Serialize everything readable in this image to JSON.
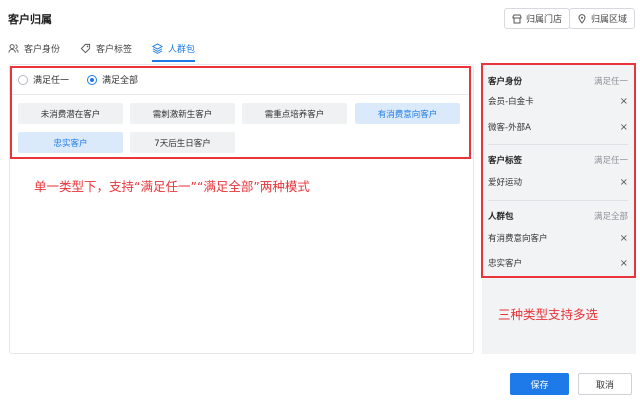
{
  "header": {
    "title": "客户归属",
    "store_button": "归属门店",
    "region_button": "归属区域"
  },
  "tabs": [
    {
      "label": "客户身份",
      "icon": "users-icon"
    },
    {
      "label": "客户标签",
      "icon": "tag-icon"
    },
    {
      "label": "人群包",
      "icon": "layers-icon",
      "active": true
    }
  ],
  "match_mode": {
    "options": [
      "满足任一",
      "满足全部"
    ],
    "selected": "满足全部"
  },
  "chips": [
    {
      "label": "未消费潜在客户",
      "selected": false
    },
    {
      "label": "需刺激新生客户",
      "selected": false
    },
    {
      "label": "需重点培养客户",
      "selected": false
    },
    {
      "label": "有消费意向客户",
      "selected": true
    },
    {
      "label": "忠实客户",
      "selected": true
    },
    {
      "label": "7天后生日客户",
      "selected": false
    }
  ],
  "annotations": {
    "left": "单一类型下，支持“满足任一”“满足全部”两种模式",
    "right": "三种类型支持多选"
  },
  "selection_panel": {
    "groups": [
      {
        "title": "客户身份",
        "mode": "满足任一",
        "items": [
          "会员-白金卡",
          "微客-外部A"
        ]
      },
      {
        "title": "客户标签",
        "mode": "满足任一",
        "items": [
          "爱好运动"
        ]
      },
      {
        "title": "人群包",
        "mode": "满足全部",
        "items": [
          "有消费意向客户",
          "忠实客户"
        ]
      }
    ],
    "remove_glyph": "×"
  },
  "footer": {
    "save": "保存",
    "cancel": "取消"
  },
  "colors": {
    "accent": "#1e7ae8",
    "annotation_red": "#e8343a",
    "chip_bg": "#f0f1f3",
    "chip_selected_bg": "#dbeafb",
    "side_bg": "#f2f3f5"
  }
}
